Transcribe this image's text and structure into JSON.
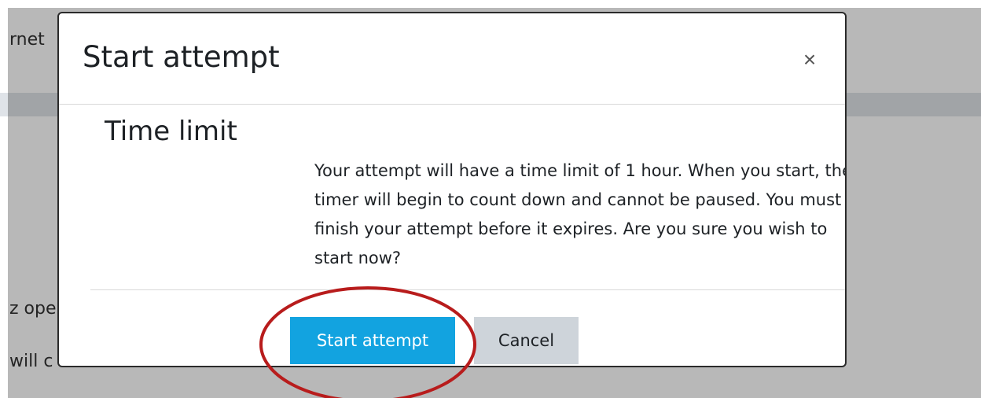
{
  "background": {
    "fragment_1": "rnet",
    "fragment_2": "z ope",
    "fragment_3": "will c"
  },
  "dialog": {
    "title": "Start attempt",
    "close_symbol": "×",
    "section_heading": "Time limit",
    "message": "Your attempt will have a time limit of 1 hour. When you start, the timer will begin to count down and cannot be paused. You must finish your attempt before it expires. Are you sure you wish to start now?",
    "primary_button_label": "Start attempt",
    "secondary_button_label": "Cancel"
  },
  "colors": {
    "primary_button": "#12a3e0",
    "secondary_button": "#ced4da",
    "highlight_ring": "#b81c1c"
  },
  "annotation": {
    "shape": "ellipse",
    "target": "Start attempt button"
  }
}
